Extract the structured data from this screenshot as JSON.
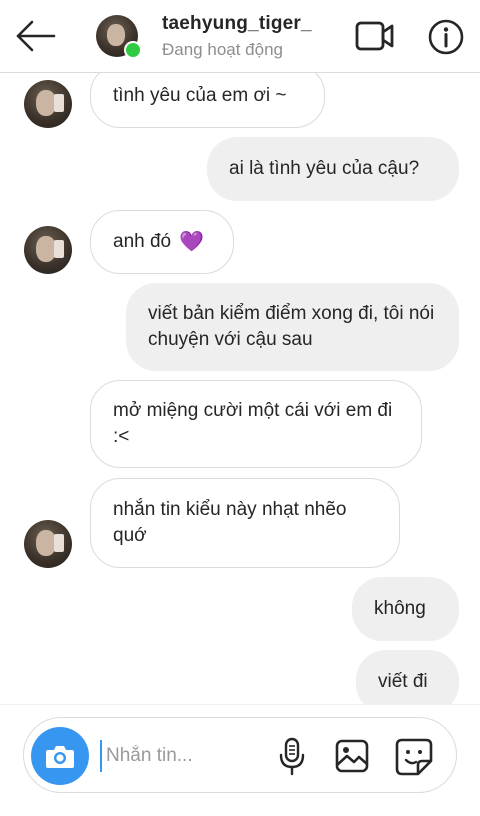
{
  "header": {
    "username": "taehyung_tiger_",
    "status": "Đang hoạt động"
  },
  "messages": [
    {
      "side": "in",
      "text": "tình yêu của em ơi ~"
    },
    {
      "side": "out",
      "text": "ai là tình yêu của cậu?"
    },
    {
      "side": "in",
      "text": "anh đó",
      "emoji": "💜"
    },
    {
      "side": "out",
      "text": "viết bản kiểm điểm xong đi, tôi nói chuyện với cậu sau"
    },
    {
      "side": "in",
      "text": "mở miệng cười một cái với em đi :<"
    },
    {
      "side": "in",
      "text": "nhắn tin kiểu này nhạt nhẽo quớ"
    },
    {
      "side": "out",
      "text": "không"
    },
    {
      "side": "out",
      "text": "viết đi"
    }
  ],
  "composer": {
    "placeholder": "Nhắn tin..."
  },
  "icons": {
    "back": "arrow-left-icon",
    "video": "video-camera-icon",
    "info": "info-icon",
    "camera": "camera-icon",
    "mic": "microphone-icon",
    "gallery": "image-icon",
    "sticker": "sticker-icon"
  },
  "colors": {
    "accent": "#3797f0",
    "online": "#2ecc40",
    "incoming_bubble_border": "#dbdbdb",
    "outgoing_bubble": "#efefef",
    "heart": "#9b59d6"
  }
}
